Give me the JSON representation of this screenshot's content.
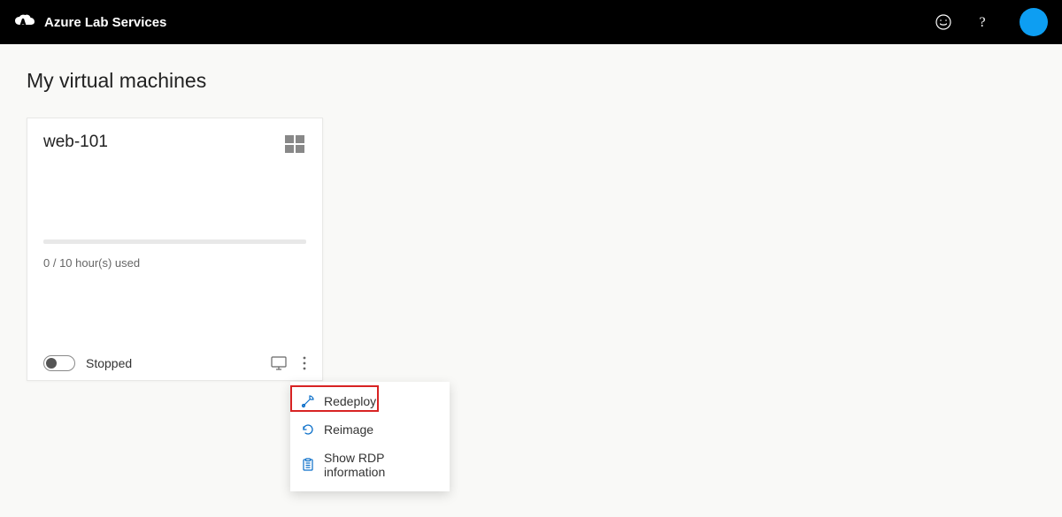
{
  "header": {
    "brand": "Azure Lab Services"
  },
  "page": {
    "title": "My virtual machines"
  },
  "vm_card": {
    "name": "web-101",
    "usage": "0 / 10 hour(s) used",
    "status": "Stopped"
  },
  "menu": {
    "items": [
      {
        "label": "Redeploy"
      },
      {
        "label": "Reimage"
      },
      {
        "label": "Show RDP information"
      }
    ]
  }
}
